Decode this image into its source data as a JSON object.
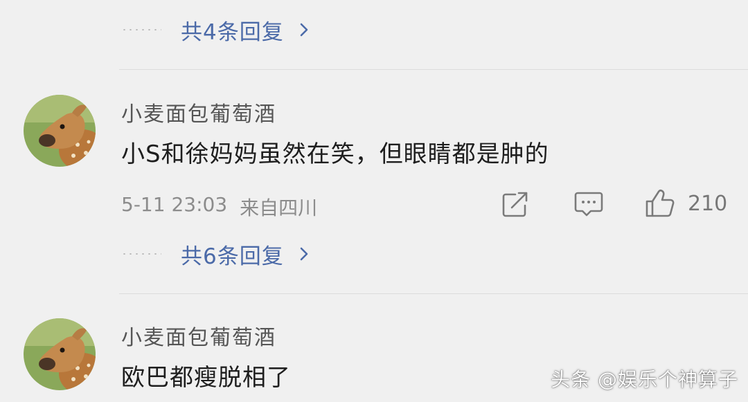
{
  "thread_top": {
    "replies_label": "共4条回复"
  },
  "comments": [
    {
      "username": "小麦面包葡萄酒",
      "text": "小S和徐妈妈虽然在笑，但眼睛都是肿的",
      "timestamp": "5-11 23:03",
      "location": "来自四川",
      "likes": "210",
      "replies_label": "共6条回复"
    },
    {
      "username": "小麦面包葡萄酒",
      "text": "欧巴都瘦脱相了"
    }
  ],
  "watermark": "头条 @娱乐个神算子",
  "colors": {
    "background": "#f0f0f0",
    "link": "#4b6aa8",
    "meta": "#8c8c8c"
  },
  "icons": [
    "chevron-right-icon",
    "share-icon",
    "comment-icon",
    "like-icon"
  ]
}
